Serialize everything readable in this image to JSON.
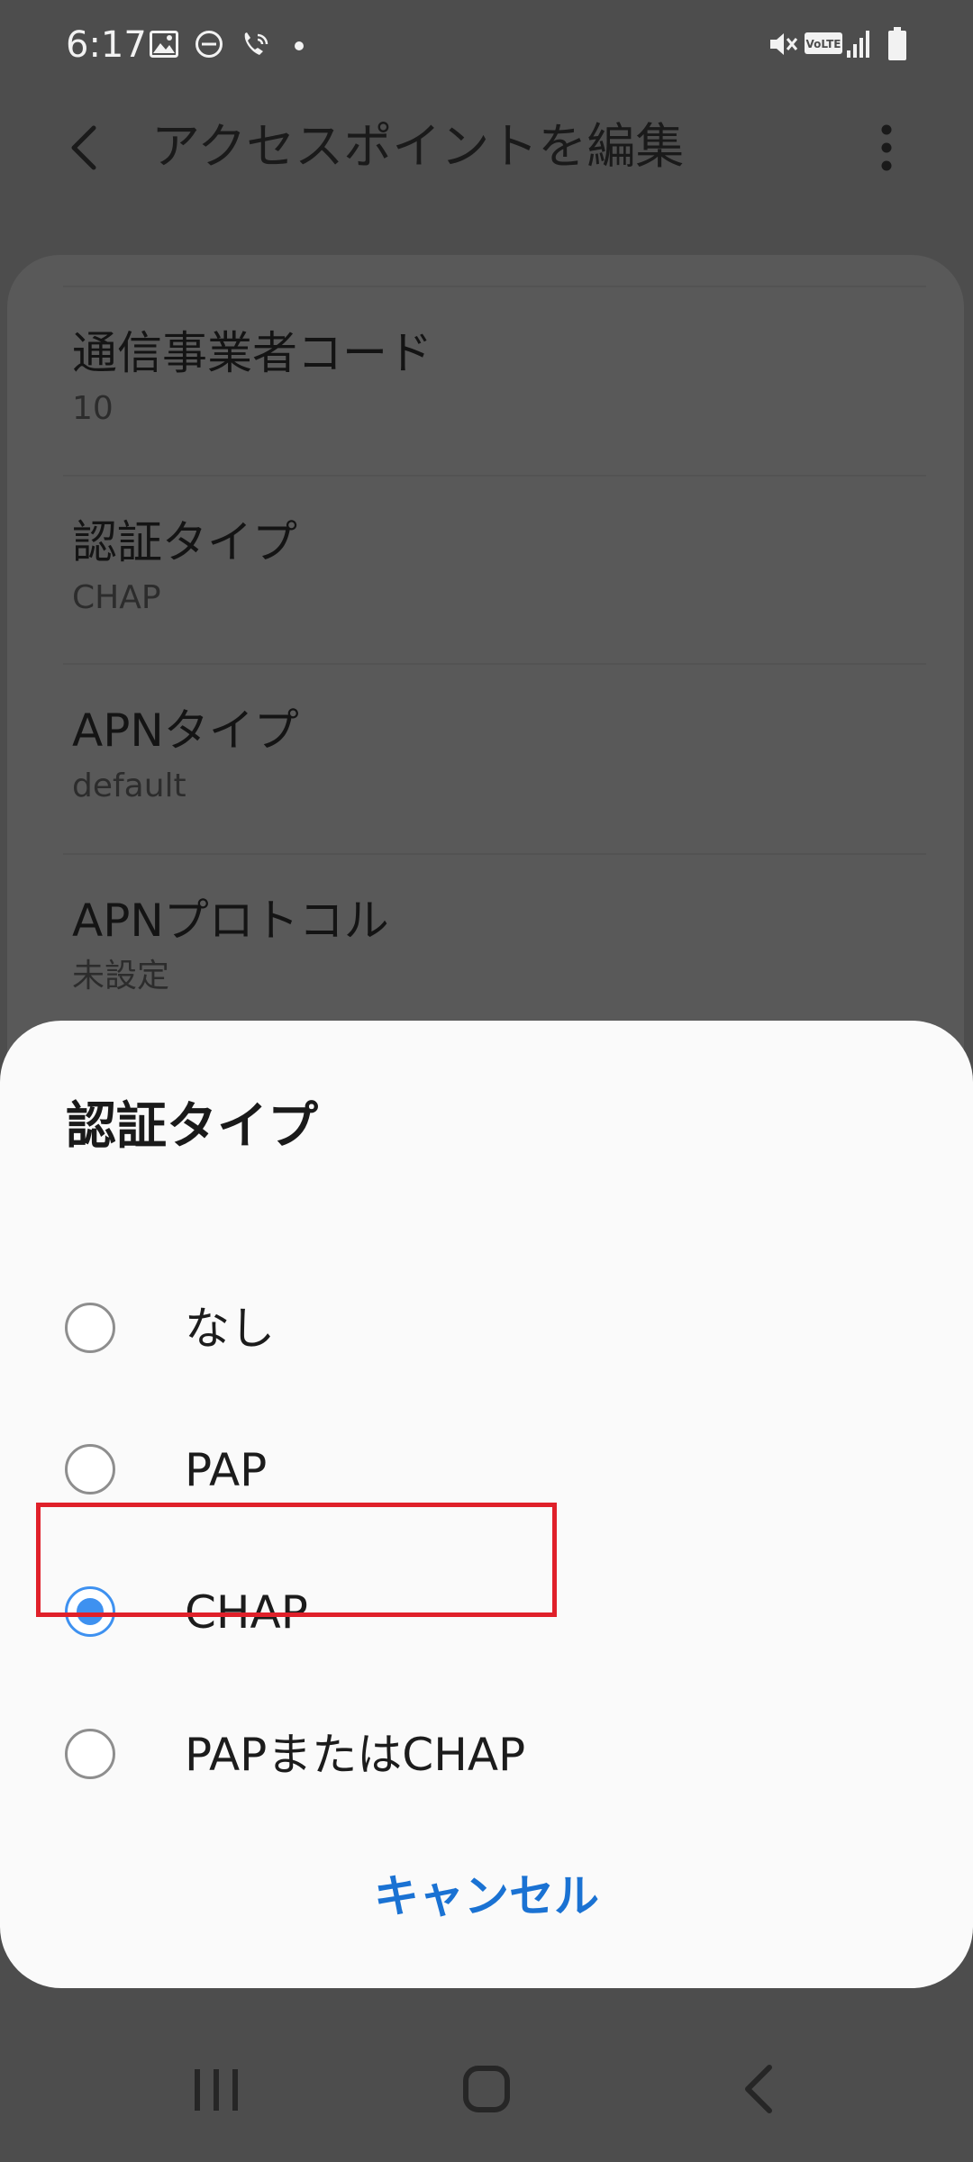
{
  "status_bar": {
    "time": "6:17",
    "left_icons": [
      "gallery-icon",
      "do-not-disturb-icon",
      "wifi-calling-icon",
      "notification-dot-icon"
    ],
    "right_icons": [
      "mute-icon",
      "volte-icon",
      "signal-icon",
      "battery-icon"
    ],
    "volte_label": "VoLTE"
  },
  "app_bar": {
    "title": "アクセスポイントを編集",
    "back_icon": "back-arrow-icon",
    "more_icon": "more-vertical-icon"
  },
  "settings": [
    {
      "title": "通信事業者コード",
      "value": "10"
    },
    {
      "title": "認証タイプ",
      "value": "CHAP"
    },
    {
      "title": "APNタイプ",
      "value": "default"
    },
    {
      "title": "APNプロトコル",
      "value": "未設定"
    }
  ],
  "dialog": {
    "title": "認証タイプ",
    "options": [
      {
        "label": "なし",
        "selected": false
      },
      {
        "label": "PAP",
        "selected": false
      },
      {
        "label": "CHAP",
        "selected": true
      },
      {
        "label": "PAPまたはCHAP",
        "selected": false
      }
    ],
    "cancel_label": "キャンセル",
    "highlight_color": "#e0202a",
    "accent_color": "#3e91f0"
  },
  "nav_bar": {
    "icons": [
      "recent-apps-icon",
      "home-icon",
      "back-icon"
    ]
  },
  "colors": {
    "scrim_background": "#4d4d4d",
    "dialog_background": "#fafafa",
    "cancel_text": "#1a72d3"
  }
}
